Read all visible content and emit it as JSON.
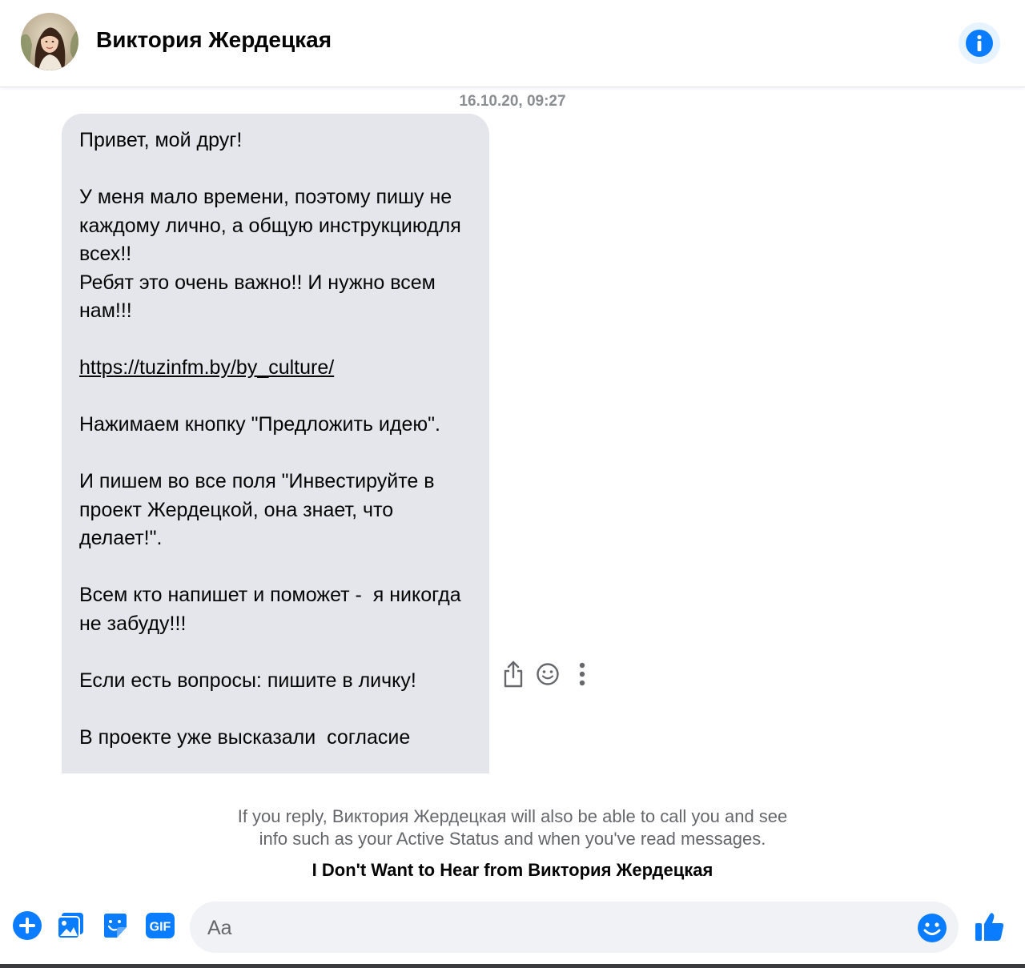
{
  "colors": {
    "accent": "#0a7cff",
    "bubble_bg": "#e4e6eb",
    "muted_text": "#65676b",
    "timestamp_text": "#8a8d91"
  },
  "header": {
    "contact_name": "Виктория Жердецкая",
    "avatar_icon": "avatar",
    "info_icon": "info-icon"
  },
  "conversation": {
    "timestamp": "16.10.20, 09:27",
    "message": {
      "paragraphs": [
        "Привет, мой друг!",
        "У меня мало времени, поэтому пишу не каждому лично, а общую инструкциюдля всех!!\nРебят это очень важно!! И нужно всем нам!!!",
        "Нажимаем кнопку \"Предложить идею\".",
        "И пишем во все поля \"Инвестируйте в проект Жердецкой, она знает, что делает!\".",
        "Всем кто напишет и поможет -  я никогда не забуду!!!",
        "Если есть вопросы: пишите в личку!",
        "В проекте уже высказали  согласие"
      ],
      "link": "https://tuzinfm.by/by_culture/"
    },
    "actions": [
      "share-icon",
      "react-icon",
      "more-icon"
    ]
  },
  "notice": {
    "line1": "If you reply, Виктория Жердецкая will also be able to call you and see",
    "line2": "info such as your Active Status and when you've read messages.",
    "block_label": "I Don't Want to Hear from Виктория Жердецкая"
  },
  "composer": {
    "placeholder": "Aa",
    "value": "",
    "tools": [
      "plus-icon",
      "photo-icon",
      "sticker-icon",
      "gif-icon"
    ],
    "gif_label": "GIF",
    "emoji_icon": "emoji-icon",
    "send_icon": "thumbs-up-icon"
  }
}
